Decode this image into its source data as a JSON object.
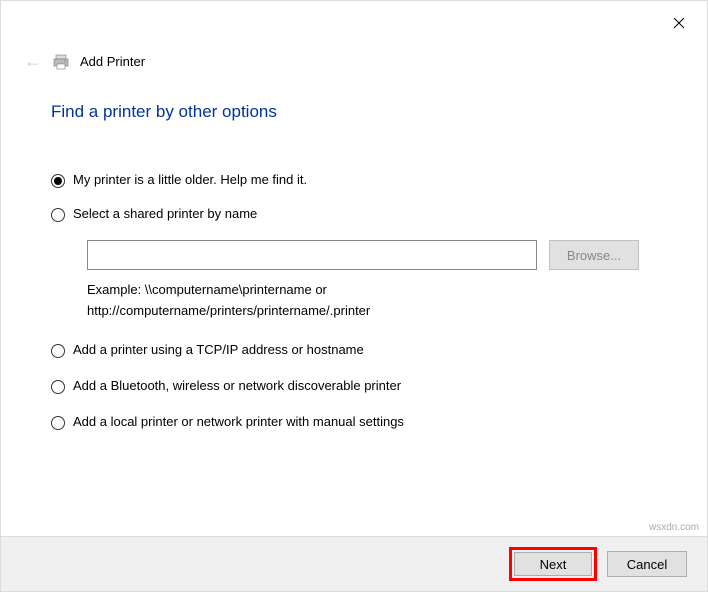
{
  "header": {
    "wizard_title": "Add Printer"
  },
  "heading": "Find a printer by other options",
  "options": {
    "older": "My printer is a little older. Help me find it.",
    "shared": "Select a shared printer by name",
    "tcpip": "Add a printer using a TCP/IP address or hostname",
    "bluetooth": "Add a Bluetooth, wireless or network discoverable printer",
    "local": "Add a local printer or network printer with manual settings"
  },
  "shared_section": {
    "input_value": "",
    "browse_label": "Browse...",
    "example_line1": "Example: \\\\computername\\printername or",
    "example_line2": "http://computername/printers/printername/.printer"
  },
  "footer": {
    "next": "Next",
    "cancel": "Cancel"
  },
  "watermark": "wsxdn.com"
}
